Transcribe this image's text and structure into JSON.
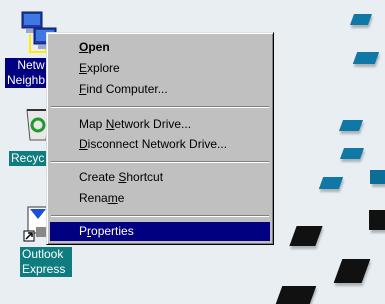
{
  "desktop": {
    "background_color": "#e8eef2",
    "pane_color": "#0f78a6",
    "label_bg": "#0f7c7f",
    "icons": [
      {
        "name": "network-neighborhood",
        "line1": "Netw",
        "line2": "Neighb"
      },
      {
        "name": "recycle-bin",
        "line1": "Recyc"
      },
      {
        "name": "outlook-express",
        "line1": "Outlook",
        "line2": "Express"
      }
    ]
  },
  "context_menu": {
    "items": [
      {
        "pre": "",
        "key": "O",
        "post": "pen",
        "bold": true
      },
      {
        "pre": "",
        "key": "E",
        "post": "xplore"
      },
      {
        "pre": "",
        "key": "F",
        "post": "ind Computer..."
      },
      {
        "pre": "Map ",
        "key": "N",
        "post": "etwork Drive..."
      },
      {
        "pre": "",
        "key": "D",
        "post": "isconnect Network Drive..."
      },
      {
        "pre": "Create ",
        "key": "S",
        "post": "hortcut"
      },
      {
        "pre": "Rena",
        "key": "m",
        "post": "e"
      },
      {
        "pre": "P",
        "key": "r",
        "post": "operties",
        "selected": true
      }
    ]
  }
}
